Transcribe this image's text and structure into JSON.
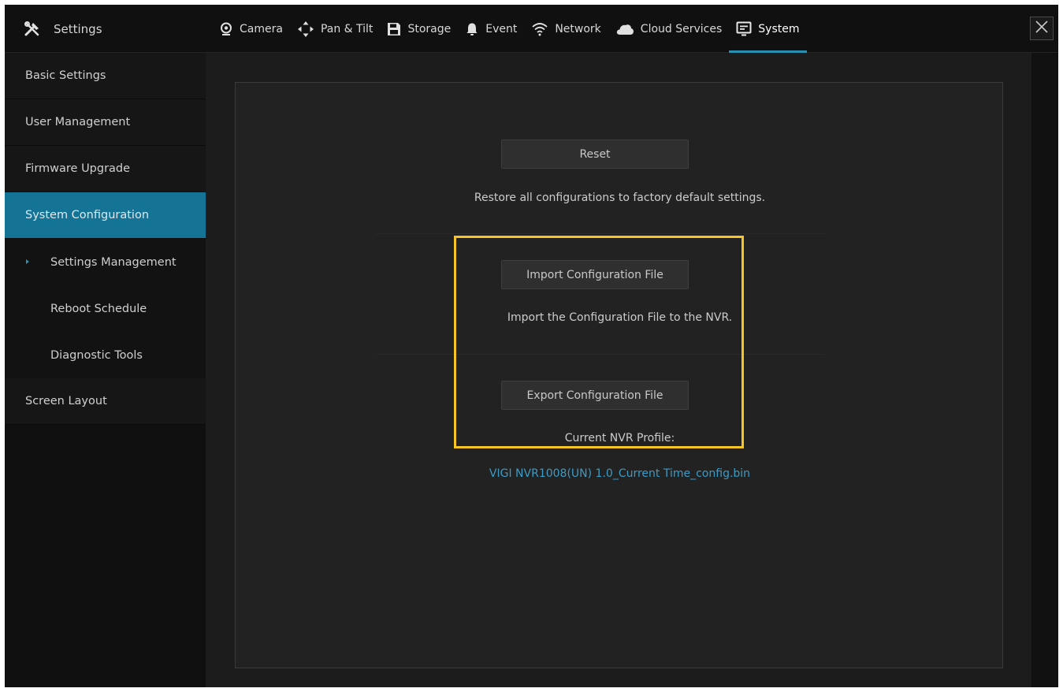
{
  "header": {
    "brand_label": "Settings",
    "tabs": [
      {
        "label": "Camera",
        "icon": "camera-icon"
      },
      {
        "label": "Pan & Tilt",
        "icon": "pan-tilt-icon"
      },
      {
        "label": "Storage",
        "icon": "storage-icon"
      },
      {
        "label": "Event",
        "icon": "bell-icon"
      },
      {
        "label": "Network",
        "icon": "wifi-icon"
      },
      {
        "label": "Cloud Services",
        "icon": "cloud-icon"
      },
      {
        "label": "System",
        "icon": "monitor-icon",
        "active": true
      }
    ],
    "close_icon": "close-icon"
  },
  "sidebar": {
    "items": [
      {
        "label": "Basic Settings"
      },
      {
        "label": "User Management"
      },
      {
        "label": "Firmware Upgrade"
      },
      {
        "label": "System Configuration",
        "active": true
      },
      {
        "label": "Settings Management",
        "sub": true,
        "current": true
      },
      {
        "label": "Reboot Schedule",
        "sub": true
      },
      {
        "label": "Diagnostic Tools",
        "sub": true
      },
      {
        "label": "Screen Layout"
      }
    ]
  },
  "main": {
    "reset_button": "Reset",
    "reset_desc": "Restore all configurations to factory default settings.",
    "import_button": "Import Configuration File",
    "import_desc": "Import the Configuration File to the NVR.",
    "export_button": "Export Configuration File",
    "profile_label": "Current NVR Profile:",
    "profile_file": "VIGI NVR1008(UN) 1.0_Current Time_config.bin"
  },
  "colors": {
    "accent": "#157396",
    "link": "#3c9bc4",
    "highlight": "#f6c427",
    "background": "#1c1c1c"
  }
}
